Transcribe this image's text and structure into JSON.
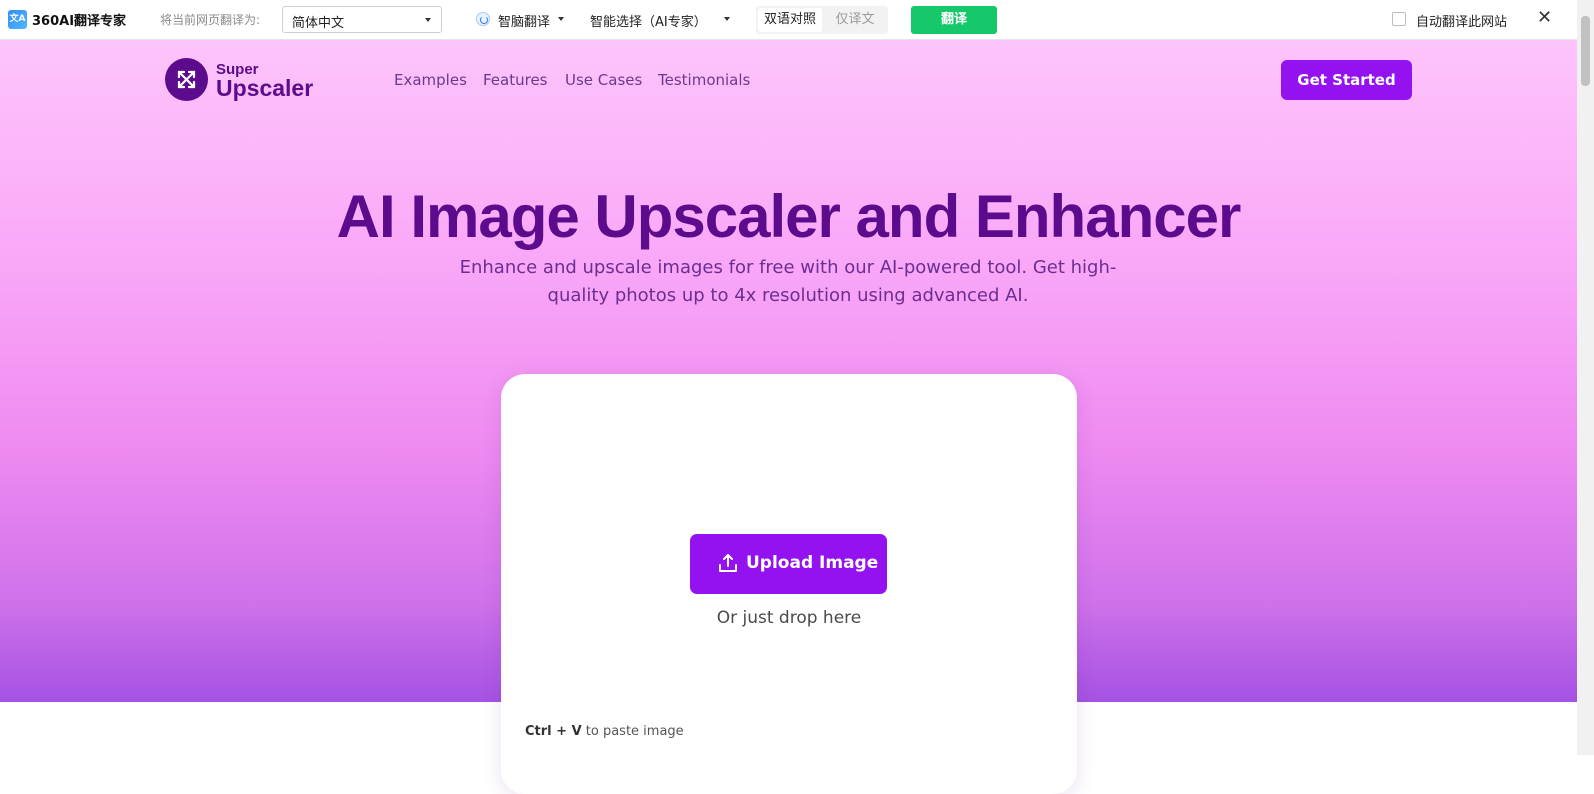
{
  "translate_bar": {
    "logo_text": "文A",
    "brand": "360AI翻译专家",
    "target_label": "将当前网页翻译为:",
    "target_language": "简体中文",
    "engine": "智脑翻译",
    "model": "智能选择（AI专家）",
    "mode_bilingual": "双语对照",
    "mode_translation_only": "仅译文",
    "translate_button": "翻译",
    "auto_translate_label": "自动翻译此网站",
    "close_glyph": "✕"
  },
  "site": {
    "brand_top": "Super",
    "brand_bottom": "Upscaler",
    "nav": [
      "Examples",
      "Features",
      "Use Cases",
      "Testimonials"
    ],
    "cta": "Get Started"
  },
  "hero": {
    "title": "AI Image Upscaler and Enhancer",
    "subtitle": "Enhance and upscale images for free with our AI-powered tool. Get high-quality photos up to 4x resolution using advanced AI."
  },
  "upload": {
    "button": "Upload Image",
    "drop_hint": "Or just drop here",
    "paste_keys": "Ctrl + V",
    "paste_rest": " to paste image"
  },
  "colors": {
    "brand_purple": "#9312ef",
    "deep_purple": "#5b0b8c",
    "translate_green": "#17c86a"
  }
}
